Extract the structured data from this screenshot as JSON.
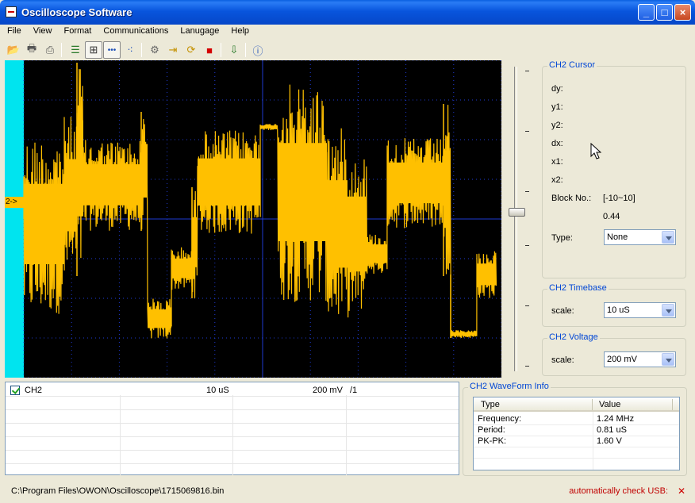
{
  "window": {
    "title": "Oscilloscope Software"
  },
  "menu": [
    "File",
    "View",
    "Format",
    "Communications",
    "Lanugage",
    "Help"
  ],
  "toolbar_icons": [
    "open-icon",
    "print-icon",
    "print-preview-icon",
    "list-icon",
    "grid-icon",
    "dotted-line-icon",
    "dots-icon",
    "settings-gears-icon",
    "import-icon",
    "refresh-icon",
    "stop-icon",
    "export-icon",
    "help-icon"
  ],
  "scope": {
    "channel_marker": "2->",
    "trace_color": "#ffc000",
    "grid_color": "#1e3ad0",
    "channel_strip_color": "#00e4ef"
  },
  "cursor_panel": {
    "title": "CH2 Cursor",
    "labels": {
      "dy": "dy:",
      "y1": "y1:",
      "y2": "y2:",
      "dx": "dx:",
      "x1": "x1:",
      "x2": "x2:"
    },
    "block_label": "Block No.:",
    "block_range": "[-10~10]",
    "block_value": "0.44",
    "type_label": "Type:",
    "type_value": "None"
  },
  "timebase_panel": {
    "title": "CH2 Timebase",
    "scale_label": "scale:",
    "scale_value": "10 uS"
  },
  "voltage_panel": {
    "title": "CH2 Voltage",
    "scale_label": "scale:",
    "scale_value": "200 mV"
  },
  "channel_list": {
    "name": "CH2",
    "timebase": "10 uS",
    "voltage": "200 mV",
    "probe": "/1"
  },
  "waveform_info": {
    "title": "CH2 WaveForm Info",
    "columns": [
      "Type",
      "Value"
    ],
    "rows": [
      {
        "type": "Frequency:",
        "value": "1.24 MHz"
      },
      {
        "type": "Period:",
        "value": "0.81 uS"
      },
      {
        "type": "PK-PK:",
        "value": "1.60 V"
      }
    ]
  },
  "status": {
    "file_path": "C:\\Program Files\\OWON\\Oscilloscope\\1715069816.bin",
    "usb_text": "automatically check USB:"
  }
}
